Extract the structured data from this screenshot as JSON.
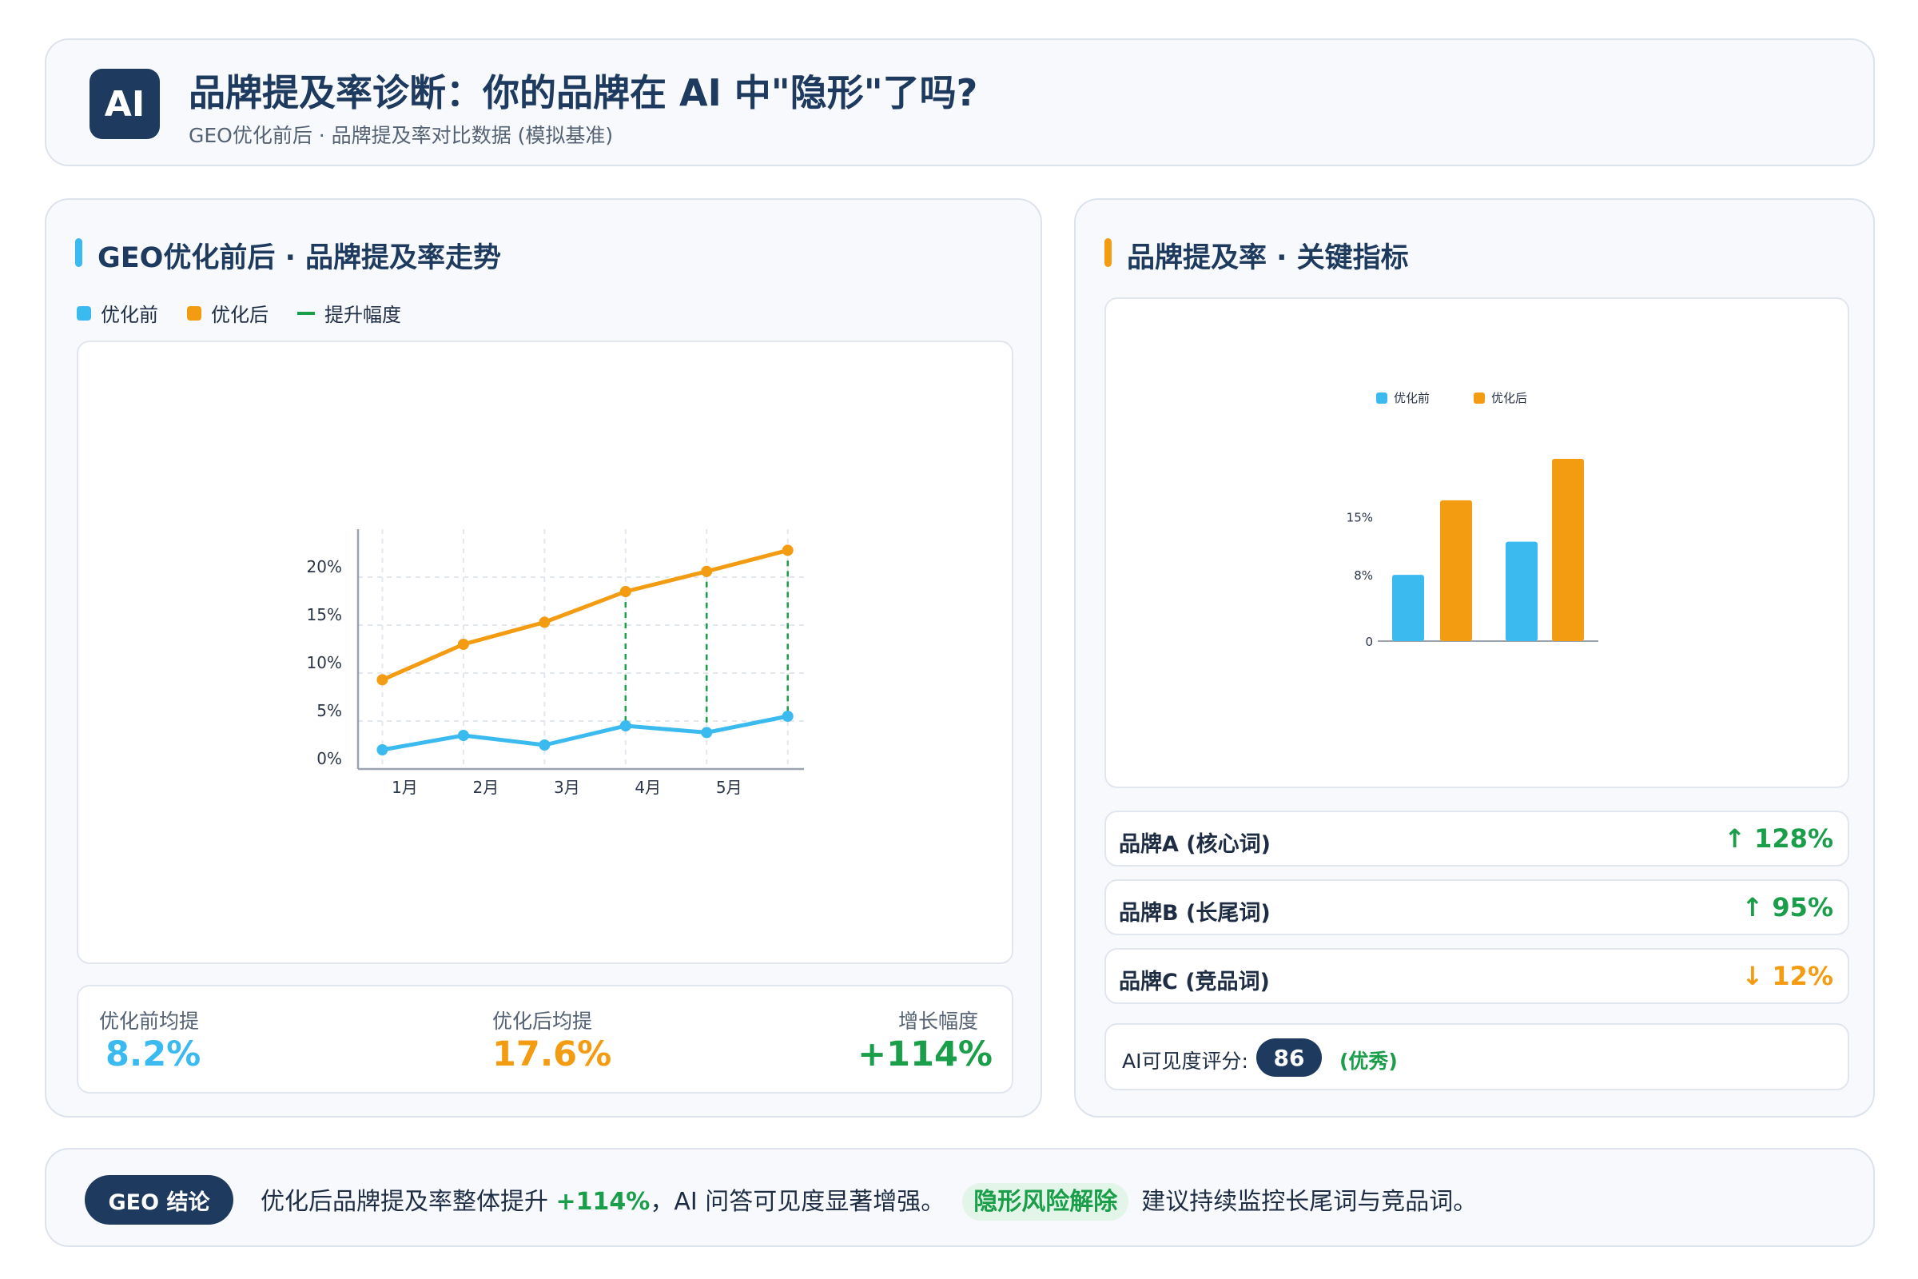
{
  "header": {
    "logo": "AI",
    "title": "品牌提及率诊断：你的品牌在 AI 中\"隐形\"了吗?",
    "subtitle": "GEO优化前后 · 品牌提及率对比数据 (模拟基准)"
  },
  "left_panel": {
    "title": "GEO优化前后 · 品牌提及率走势",
    "legend": [
      "优化前",
      "优化后",
      "提升幅度"
    ],
    "stats": [
      {
        "label": "优化前均提",
        "value": "8.2%"
      },
      {
        "label": "优化后均提",
        "value": "17.6%"
      },
      {
        "label": "增长幅度",
        "value": "+114%"
      }
    ]
  },
  "right_panel": {
    "title": "品牌提及率 · 关键指标",
    "metrics": [
      {
        "name": "品牌A (核心词)",
        "change": "↑ 128%",
        "direction": "up"
      },
      {
        "name": "品牌B (长尾词)",
        "change": "↑ 95%",
        "direction": "up"
      },
      {
        "name": "品牌C (竞品词)",
        "change": "↓ 12%",
        "direction": "down"
      }
    ],
    "score": {
      "label": "AI可见度评分:",
      "value": "86",
      "grade": "(优秀)"
    }
  },
  "footer": {
    "badge": "GEO 结论",
    "text_pre": "优化后品牌提及率整体提升",
    "text_highlight": "+114%",
    "text_mid": "，AI 问答可见度显著增强。",
    "tag": "隐形风险解除",
    "text_post": "建议持续监控长尾词与竞品词。"
  },
  "colors": {
    "before": "#3bbaf0",
    "after": "#f39c12",
    "lift": "#1a9e4a",
    "navy": "#1f3a5f",
    "down": "#f39c12"
  },
  "chart_data": [
    {
      "type": "line",
      "x_labels": [
        "1月",
        "2月",
        "3月",
        "4月",
        "5月"
      ],
      "x": [
        1,
        2,
        3,
        4,
        5,
        6
      ],
      "xlim": [
        0.7,
        6.2
      ],
      "ylim": [
        0,
        25
      ],
      "y_ticks": [
        0,
        5,
        10,
        15,
        20
      ],
      "y_tick_labels": [
        "0%",
        "5%",
        "10%",
        "15%",
        "20%"
      ],
      "grid": true,
      "series": [
        {
          "name": "优化前",
          "values": [
            2.0,
            3.5,
            2.5,
            4.5,
            3.8,
            5.5
          ]
        },
        {
          "name": "优化后",
          "values": [
            9.3,
            13.0,
            15.3,
            18.5,
            20.6,
            22.8
          ]
        }
      ],
      "lift_lines_x": [
        4,
        5,
        6
      ]
    },
    {
      "type": "bar",
      "legend": [
        "优化前",
        "优化后"
      ],
      "legend_position": "top",
      "y_ticks": [
        0,
        8,
        15
      ],
      "y_tick_labels": [
        "0",
        "8%",
        "15%"
      ],
      "ylim": [
        0,
        22
      ],
      "series": [
        {
          "name": "优化前",
          "values": [
            8,
            12
          ]
        },
        {
          "name": "优化后",
          "values": [
            17,
            22
          ]
        }
      ]
    }
  ]
}
